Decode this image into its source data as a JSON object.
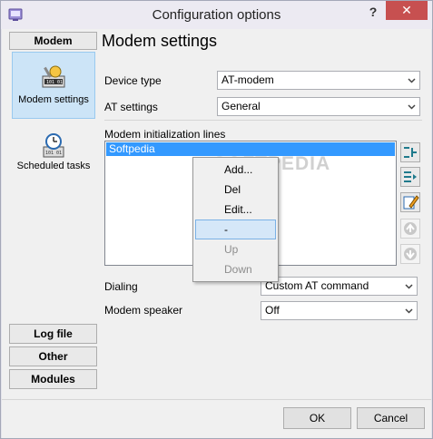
{
  "window": {
    "title": "Configuration options",
    "help_label": "?",
    "close_label": "✕"
  },
  "nav": {
    "header": "Modem",
    "items": [
      {
        "label": "Modem settings",
        "icon": "modem-settings-icon"
      },
      {
        "label": "Scheduled tasks",
        "icon": "clock-icon"
      }
    ],
    "footer": [
      "Log file",
      "Other",
      "Modules"
    ]
  },
  "page": {
    "title": "Modem settings",
    "device_type_label": "Device type",
    "device_type_value": "AT-modem",
    "at_settings_label": "AT settings",
    "at_settings_value": "General",
    "init_lines_label": "Modem initialization lines",
    "init_lines": [
      "Softpedia"
    ],
    "dialing_label": "Dialing",
    "dialing_value": "Custom AT command",
    "speaker_label": "Modem speaker",
    "speaker_value": "Off"
  },
  "watermark": "SOFTPEDIA",
  "context_menu": {
    "items": [
      {
        "label": "Add..."
      },
      {
        "label": "Del"
      },
      {
        "label": "Edit..."
      },
      {
        "label": "-"
      },
      {
        "label": "Up"
      },
      {
        "label": "Down"
      }
    ]
  },
  "buttons": {
    "ok": "OK",
    "cancel": "Cancel"
  },
  "colors": {
    "accent": "#3399ff",
    "close": "#c75050",
    "selection": "#cce4f7"
  }
}
